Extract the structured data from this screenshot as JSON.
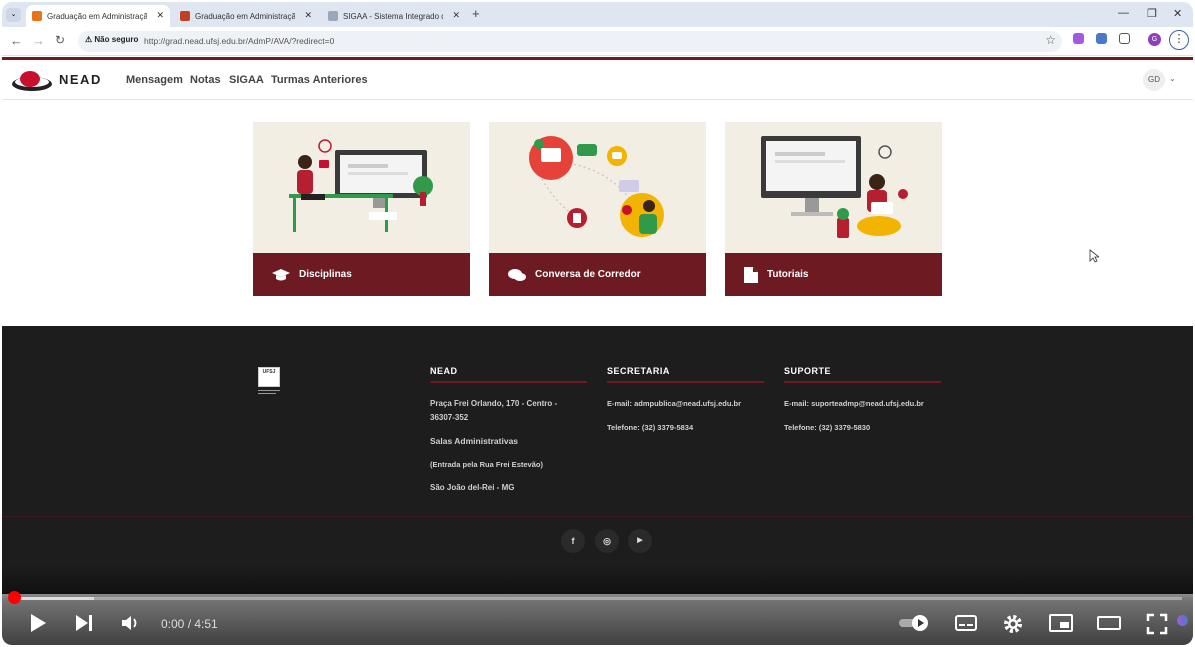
{
  "browser": {
    "tabs": [
      {
        "title": "Graduação em Administração P",
        "fav_color": "#e8711a",
        "active": true
      },
      {
        "title": "Graduação em Administração P",
        "fav_color": "#c04020",
        "active": false
      },
      {
        "title": "SIGAA - Sistema Integrado de G",
        "fav_color": "#9aa7b8",
        "active": false
      }
    ],
    "security_label": "Não seguro",
    "url": "http://grad.nead.ufsj.edu.br/AdmP/AVA/?redirect=0",
    "profile_letter": "G"
  },
  "site": {
    "brand": "NEAD",
    "menu": [
      "Mensagem",
      "Notas",
      "SIGAA",
      "Turmas Anteriores"
    ],
    "user_initials": "GD",
    "accent": "#6d1a22"
  },
  "cards": [
    {
      "label": "Disciplinas",
      "icon": "graduation-cap-icon"
    },
    {
      "label": "Conversa de Corredor",
      "icon": "chat-bubbles-icon"
    },
    {
      "label": "Tutoriais",
      "icon": "document-icon"
    }
  ],
  "footer": {
    "nead": {
      "heading": "NEAD",
      "address": "Praça Frei Orlando, 170 - Centro - 36307-352",
      "rooms": "Salas Administrativas",
      "entrance": "(Entrada pela Rua Frei Estevão)",
      "city": "São João del-Rei - MG"
    },
    "secretaria": {
      "heading": "SECRETARIA",
      "email": "E-mail: admpublica@nead.ufsj.edu.br",
      "phone": "Telefone: (32) 3379-5834"
    },
    "suporte": {
      "heading": "SUPORTE",
      "email": "E-mail: suporteadmp@nead.ufsj.edu.br",
      "phone": "Telefone: (32) 3379-5830"
    },
    "logo_text": "UFSJ",
    "social": [
      {
        "name": "facebook",
        "glyph": "f"
      },
      {
        "name": "instagram",
        "glyph": "◎"
      },
      {
        "name": "youtube",
        "glyph": "▶"
      }
    ]
  },
  "player": {
    "time": "0:00 / 4:51",
    "progress_fraction": 0.0
  }
}
